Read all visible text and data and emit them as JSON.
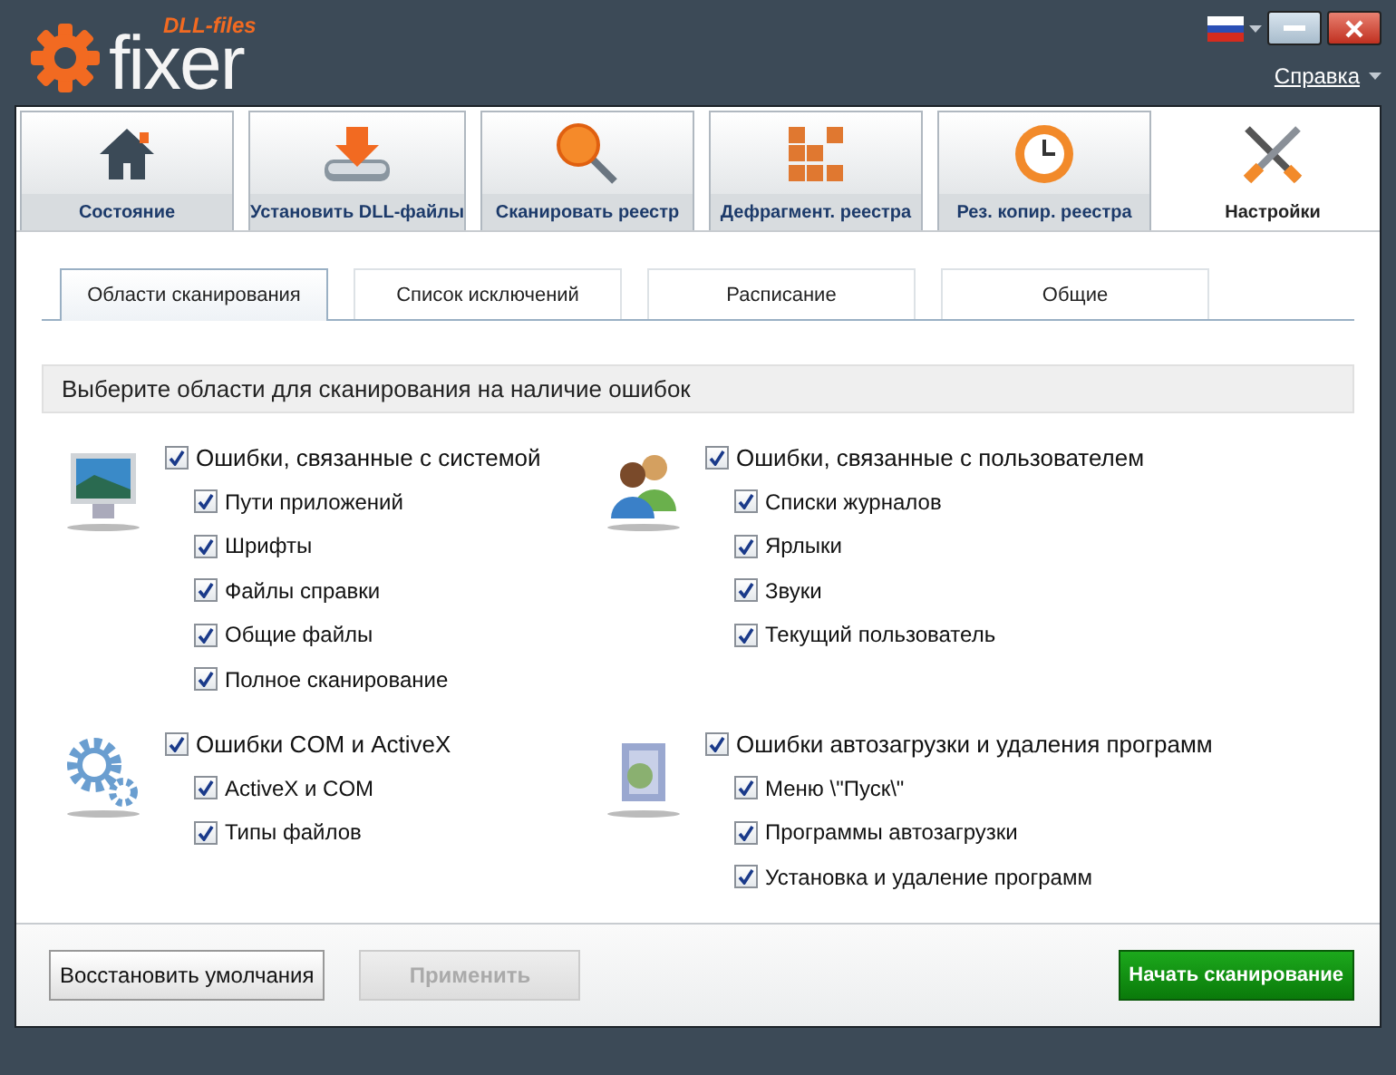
{
  "window": {
    "logo_small": "DLL-files",
    "logo": "fixer",
    "help": "Справка"
  },
  "main_tabs": [
    {
      "label": "Состояние",
      "selected": false
    },
    {
      "label": "Установить DLL-файлы",
      "selected": false
    },
    {
      "label": "Сканировать реестр",
      "selected": false
    },
    {
      "label": "Дефрагмент. реестра",
      "selected": false
    },
    {
      "label": "Рез. копир. реестра",
      "selected": false
    },
    {
      "label": "Настройки",
      "selected": true
    }
  ],
  "sub_tabs": [
    {
      "label": "Области сканирования",
      "selected": true
    },
    {
      "label": "Список исключений",
      "selected": false
    },
    {
      "label": "Расписание",
      "selected": false
    },
    {
      "label": "Общие",
      "selected": false
    }
  ],
  "section_title": "Выберите области для сканирования на наличие ошибок",
  "groups": [
    {
      "label": "Ошибки, связанные с системой",
      "checked": true,
      "items": [
        {
          "label": "Пути приложений",
          "checked": true
        },
        {
          "label": "Шрифты",
          "checked": true
        },
        {
          "label": "Файлы справки",
          "checked": true
        },
        {
          "label": "Общие файлы",
          "checked": true
        },
        {
          "label": "Полное сканирование",
          "checked": true
        }
      ]
    },
    {
      "label": "Ошибки, связанные с пользователем",
      "checked": true,
      "items": [
        {
          "label": "Списки журналов",
          "checked": true
        },
        {
          "label": "Ярлыки",
          "checked": true
        },
        {
          "label": "Звуки",
          "checked": true
        },
        {
          "label": "Текущий пользователь",
          "checked": true
        }
      ]
    },
    {
      "label": "Ошибки COM и ActiveX",
      "checked": true,
      "items": [
        {
          "label": "ActiveX и COM",
          "checked": true
        },
        {
          "label": "Типы файлов",
          "checked": true
        }
      ]
    },
    {
      "label": "Ошибки автозагрузки и удаления программ",
      "checked": true,
      "items": [
        {
          "label": "Меню \\\"Пуск\\\"",
          "checked": true
        },
        {
          "label": "Программы автозагрузки",
          "checked": true
        },
        {
          "label": "Установка и удаление программ",
          "checked": true
        }
      ]
    }
  ],
  "buttons": [
    {
      "label": "Восстановить умолчания",
      "kind": "secondary",
      "disabled": false
    },
    {
      "label": "Применить",
      "kind": "secondary",
      "disabled": true
    },
    {
      "label": "Начать сканирование",
      "kind": "primary",
      "disabled": false
    }
  ]
}
